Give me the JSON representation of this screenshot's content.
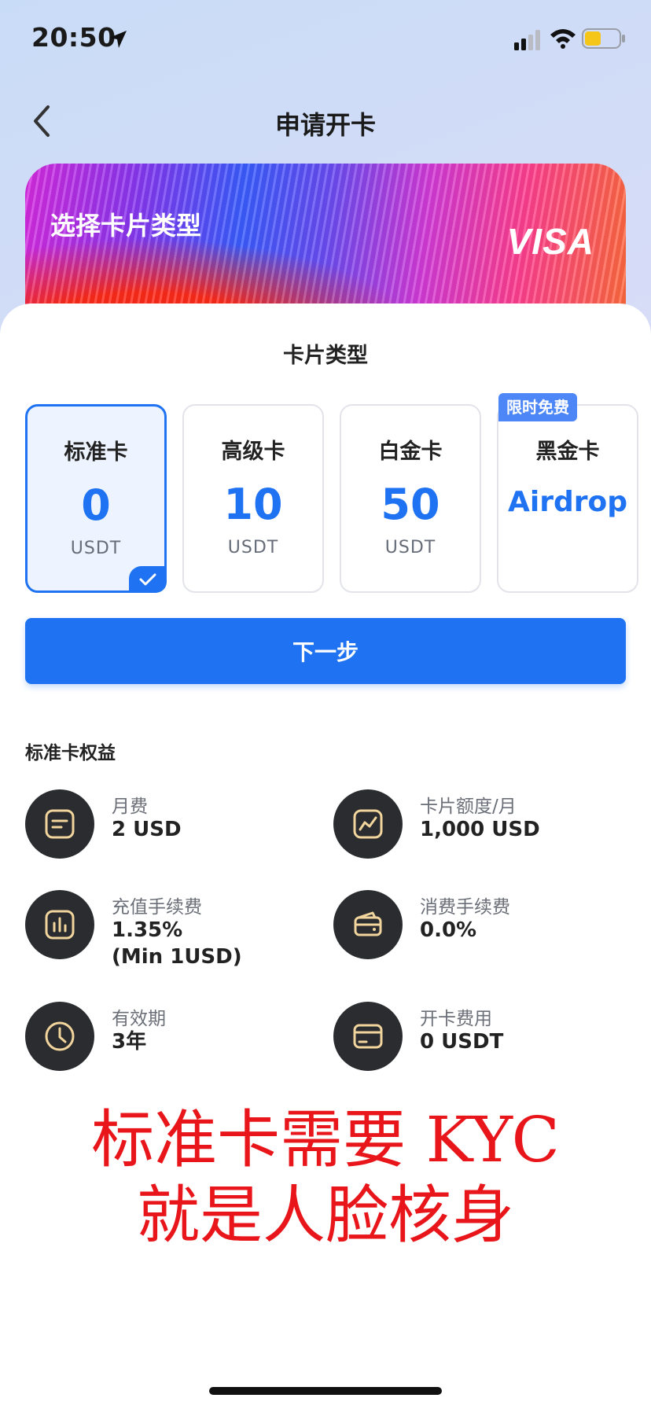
{
  "status_bar": {
    "time": "20:50"
  },
  "nav": {
    "title": "申请开卡"
  },
  "banner": {
    "title": "选择卡片类型",
    "brand": "VISA"
  },
  "card_types": {
    "title": "卡片类型",
    "options": [
      {
        "name": "标准卡",
        "price": "0",
        "unit": "USDT",
        "selected": true
      },
      {
        "name": "高级卡",
        "price": "10",
        "unit": "USDT"
      },
      {
        "name": "白金卡",
        "price": "50",
        "unit": "USDT"
      },
      {
        "name": "黑金卡",
        "price": "Airdrop",
        "badge": "限时免费"
      }
    ]
  },
  "next_button": {
    "label": "下一步"
  },
  "benefits": {
    "title": "标准卡权益",
    "items": [
      {
        "label": "月费",
        "value": "2 USD",
        "icon": "document-icon"
      },
      {
        "label": "卡片额度/月",
        "value": "1,000 USD",
        "icon": "trend-chart-icon"
      },
      {
        "label": "充值手续费",
        "value": "1.35%",
        "value2": "(Min 1USD)",
        "icon": "bar-chart-icon"
      },
      {
        "label": "消费手续费",
        "value": "0.0%",
        "icon": "wallet-icon"
      },
      {
        "label": "有效期",
        "value": "3年",
        "icon": "clock-icon"
      },
      {
        "label": "开卡费用",
        "value": "0 USDT",
        "icon": "card-icon"
      }
    ]
  },
  "annotation": {
    "line1": "标准卡需要 KYC",
    "line2": "就是人脸核身"
  },
  "colors": {
    "primary": "#1f73f2",
    "annotation": "#e8161a",
    "icon_bg": "#2a2c2f",
    "icon_gold": "#f2d59c"
  }
}
